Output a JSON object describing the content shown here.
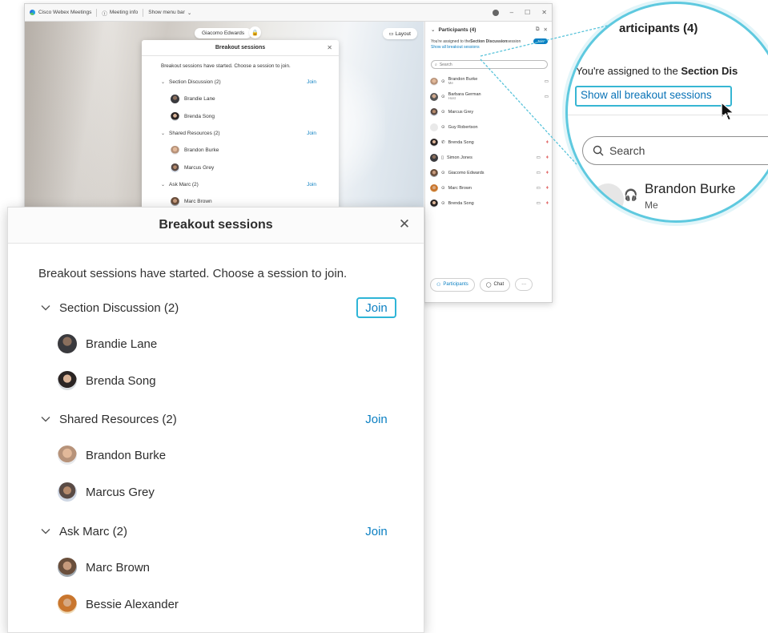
{
  "app": {
    "title": "Cisco Webex Meetings",
    "meeting_info": "Meeting info",
    "show_menu_bar": "Show menu bar",
    "presenter_name": "Giacomo Edwards",
    "layout_label": "Layout",
    "small_dialog": {
      "title": "Breakout sessions",
      "intro": "Breakout sessions have started. Choose a session to join.",
      "groups": [
        {
          "name": "Section Discussion (2)",
          "join": "Join",
          "members": [
            "Brandie Lane",
            "Brenda Song"
          ]
        },
        {
          "name": "Shared Resources (2)",
          "join": "Join",
          "members": [
            "Brandon Burke",
            "Marcus Grey"
          ]
        },
        {
          "name": "Ask Marc (2)",
          "join": "Join",
          "members": [
            "Marc Brown"
          ]
        }
      ]
    }
  },
  "participants_panel": {
    "title": "Participants (4)",
    "assigned_prefix": "You're assigned to the ",
    "assigned_session": "Section Discussion",
    "assigned_suffix": " session",
    "mini_join": "Join",
    "show_all": "Show all breakout sessions",
    "search_placeholder": "Search",
    "people": [
      {
        "name": "Brandon Burke",
        "sub": "Me"
      },
      {
        "name": "Barbara German",
        "sub": "Host"
      },
      {
        "name": "Marcus Grey",
        "sub": ""
      },
      {
        "name": "Guy Robertson",
        "sub": ""
      },
      {
        "name": "Brenda Song",
        "sub": ""
      },
      {
        "name": "Simon Jones",
        "sub": ""
      },
      {
        "name": "Giacomo Edwards",
        "sub": ""
      },
      {
        "name": "Marc Brown",
        "sub": ""
      },
      {
        "name": "Brenda Song",
        "sub": ""
      }
    ],
    "footer": {
      "participants": "Participants",
      "chat": "Chat",
      "more": "···"
    }
  },
  "zoom": {
    "title": "articipants (4)",
    "assigned_prefix": "You're assigned to the ",
    "assigned_bold": "Section Dis",
    "show_all": "Show all breakout sessions",
    "search_placeholder": "Search",
    "person_name": "Brandon Burke",
    "person_sub": "Me"
  },
  "breakout_dialog": {
    "title": "Breakout sessions",
    "close_glyph": "✕",
    "intro": "Breakout sessions have started. Choose a session to join.",
    "groups": [
      {
        "name": "Section Discussion (2)",
        "join": "Join",
        "members": [
          "Brandie Lane",
          "Brenda Song"
        ]
      },
      {
        "name": "Shared Resources (2)",
        "join": "Join",
        "members": [
          "Brandon Burke",
          "Marcus Grey"
        ]
      },
      {
        "name": "Ask Marc (2)",
        "join": "Join",
        "members": [
          "Marc Brown",
          "Bessie Alexander"
        ]
      }
    ]
  },
  "colors": {
    "accent": "#0a7fc2",
    "highlight": "#2eb5d7",
    "mute": "#d93a3a"
  }
}
